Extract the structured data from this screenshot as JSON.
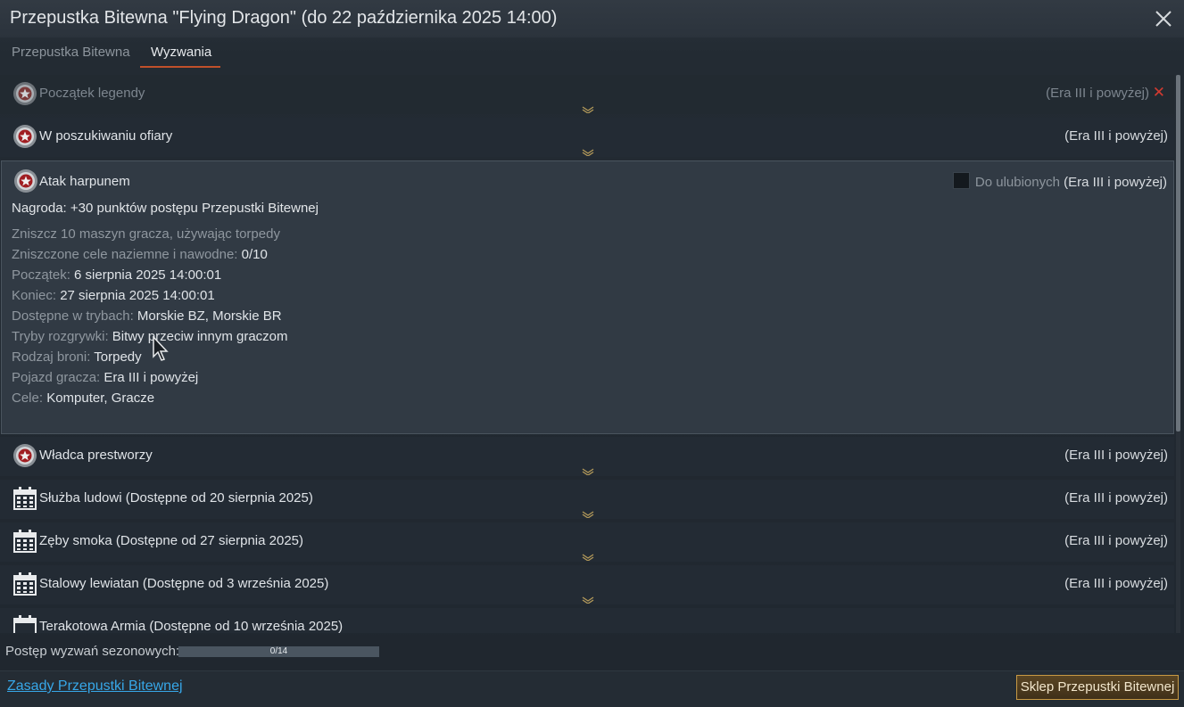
{
  "window": {
    "title": "Przepustka Bitewna \"Flying Dragon\" (do 22 października 2025 14:00)",
    "close_icon": "close-icon"
  },
  "tabs": [
    {
      "label": "Przepustka Bitewna",
      "active": false
    },
    {
      "label": "Wyzwania",
      "active": true
    }
  ],
  "challenges": [
    {
      "title": "Początek legendy",
      "era": "(Era III i powyżej)",
      "icon": "medal-icon",
      "state": "failed"
    },
    {
      "title": "W poszukiwaniu ofiary",
      "era": "(Era III i powyżej)",
      "icon": "medal-icon"
    },
    {
      "title": "Atak harpunem",
      "era": "(Era III i powyżej)",
      "icon": "medal-icon",
      "expanded": true
    },
    {
      "title": "Władca prestworzy",
      "era": "(Era III i powyżej)",
      "icon": "medal-icon"
    },
    {
      "title": "Służba ludowi (Dostępne od 20 sierpnia 2025)",
      "era": "(Era III i powyżej)",
      "icon": "calendar-icon"
    },
    {
      "title": "Zęby smoka (Dostępne od 27 sierpnia 2025)",
      "era": "(Era III i powyżej)",
      "icon": "calendar-icon"
    },
    {
      "title": "Stalowy lewiatan (Dostępne od 3 września 2025)",
      "era": "(Era III i powyżej)",
      "icon": "calendar-icon"
    },
    {
      "title": "Terakotowa Armia (Dostępne od 10 września 2025)",
      "era": "",
      "icon": "calendar-icon"
    }
  ],
  "expanded": {
    "favorite_label": "Do ulubionych",
    "reward": "Nagroda: +30 punktów postępu Przepustki Bitewnej",
    "description": "Zniszcz 10 maszyn gracza, używając torpedy",
    "fields": [
      {
        "label": "Zniszczone cele naziemne i nawodne: ",
        "value": "0/10"
      },
      {
        "label": "Początek: ",
        "value": "6 sierpnia 2025 14:00:01"
      },
      {
        "label": "Koniec: ",
        "value": "27 sierpnia 2025 14:00:01"
      },
      {
        "label": "Dostępne w trybach: ",
        "value": "Morskie BZ, Morskie BR"
      },
      {
        "label": "Tryby rozgrywki: ",
        "value": "Bitwy przeciw innym graczom"
      },
      {
        "label": "Rodzaj broni: ",
        "value": "Torpedy"
      },
      {
        "label": "Pojazd gracza: ",
        "value": "Era III i powyżej"
      },
      {
        "label": "Cele: ",
        "value": "Komputer, Gracze"
      }
    ]
  },
  "progress": {
    "label": "Postęp wyzwań sezonowych:",
    "text": "0/14",
    "fraction": 0
  },
  "footer": {
    "rules_link": "Zasady Przepustki Bitewnej",
    "shop_button": "Sklep Przepustki Bitewnej"
  },
  "colors": {
    "accent_orange": "#c0502a",
    "link_blue": "#37a7e8",
    "failed_red": "#d23a30",
    "shop_border": "#c89a44"
  }
}
